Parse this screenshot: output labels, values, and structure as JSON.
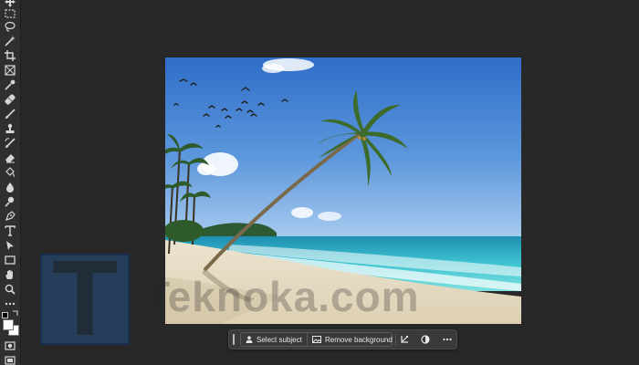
{
  "taskbar": {
    "select_subject_label": "Select subject",
    "remove_background_label": "Remove background"
  },
  "watermark": {
    "letter": "T",
    "text": "Teknoka.com"
  },
  "colors": {
    "app_background": "#282828",
    "toolbar_background": "#2f2f2f",
    "taskbar_background": "#3a3a3a",
    "foreground_color": "#ffffff",
    "background_color": "#ffffff"
  },
  "toolbar": {
    "tools": [
      "move-icon",
      "marquee-icon",
      "lasso-icon",
      "magic-wand-icon",
      "crop-icon",
      "frame-icon",
      "eyedropper-icon",
      "spot-healing-icon",
      "brush-icon",
      "clone-stamp-icon",
      "history-brush-icon",
      "eraser-icon",
      "gradient-icon",
      "blur-icon",
      "dodge-icon",
      "pen-icon",
      "type-icon",
      "path-selection-icon",
      "rectangle-icon",
      "hand-icon",
      "zoom-icon",
      "more-tools-icon"
    ]
  }
}
